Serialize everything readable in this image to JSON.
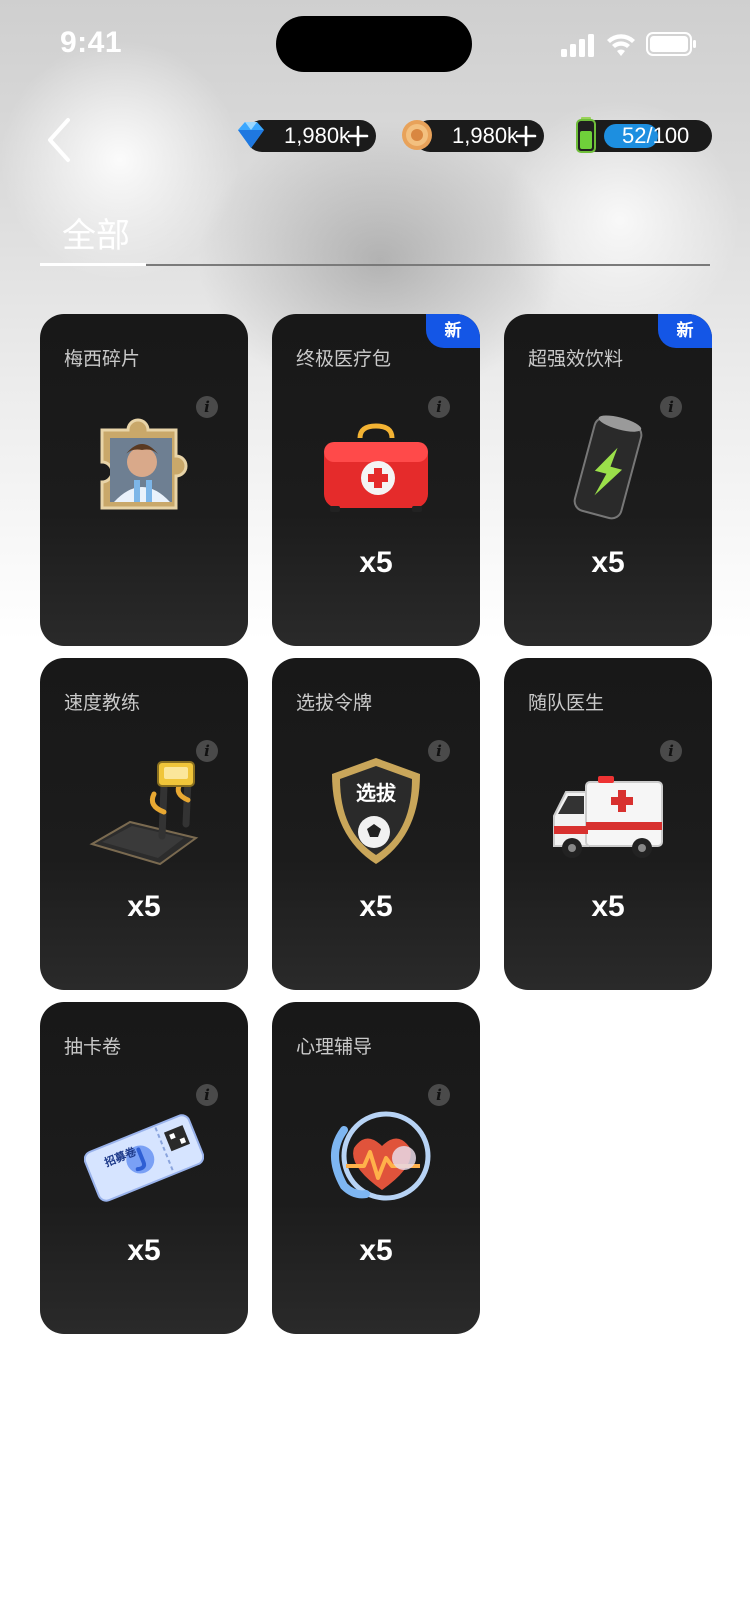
{
  "status_bar": {
    "time": "9:41"
  },
  "currency": {
    "gems": "1,980k",
    "coins": "1,980k",
    "energy": "52/100",
    "energy_fraction": 0.52
  },
  "tabs": [
    {
      "label": "全部",
      "active": true
    }
  ],
  "items": [
    {
      "title": "梅西碎片",
      "new": false,
      "quantity": "",
      "icon": "puzzle-piece-icon"
    },
    {
      "title": "终极医疗包",
      "new": true,
      "new_label": "新",
      "quantity": "x5",
      "icon": "medical-kit-icon"
    },
    {
      "title": "超强效饮料",
      "new": true,
      "new_label": "新",
      "quantity": "x5",
      "icon": "energy-drink-icon"
    },
    {
      "title": "速度教练",
      "new": false,
      "quantity": "x5",
      "icon": "treadmill-icon"
    },
    {
      "title": "选拔令牌",
      "new": false,
      "quantity": "x5",
      "icon": "selection-shield-icon",
      "badge_text": "选拔"
    },
    {
      "title": "随队医生",
      "new": false,
      "quantity": "x5",
      "icon": "ambulance-icon"
    },
    {
      "title": "抽卡卷",
      "new": false,
      "quantity": "x5",
      "icon": "recruit-ticket-icon",
      "ticket_text": "招募卷"
    },
    {
      "title": "心理辅导",
      "new": false,
      "quantity": "x5",
      "icon": "heart-monitor-icon"
    }
  ],
  "info_glyph": "i",
  "colors": {
    "card": "#1c1c1c",
    "new_tag": "#1456e6",
    "energy_bar": "#1d8fe0"
  }
}
